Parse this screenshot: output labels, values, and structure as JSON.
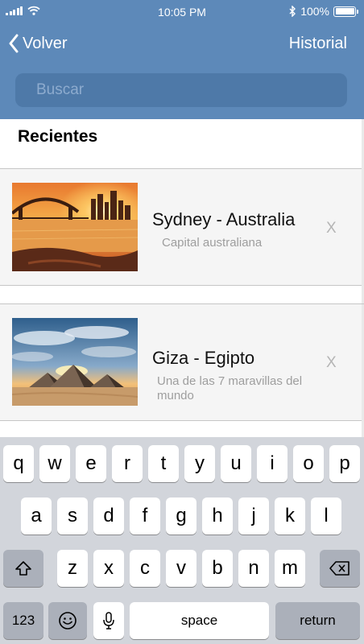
{
  "status_bar": {
    "time": "10:05 PM",
    "battery": "100%"
  },
  "nav": {
    "back_label": "Volver",
    "right_label": "Historial"
  },
  "search": {
    "placeholder": "Buscar"
  },
  "section_title": "Recientes",
  "recent_items": [
    {
      "title": "Sydney - Australia",
      "description": "Capital australiana",
      "remove": "X"
    },
    {
      "title": "Giza - Egipto",
      "description": "Una de las 7 maravillas del mundo",
      "remove": "X"
    }
  ],
  "keyboard": {
    "row1": [
      "q",
      "w",
      "e",
      "r",
      "t",
      "y",
      "u",
      "i",
      "o",
      "p"
    ],
    "row2": [
      "a",
      "s",
      "d",
      "f",
      "g",
      "h",
      "j",
      "k",
      "l"
    ],
    "row3": [
      "z",
      "x",
      "c",
      "v",
      "b",
      "n",
      "m"
    ],
    "numbers_label": "123",
    "space_label": "space",
    "return_label": "return"
  },
  "colors": {
    "header": "#5d89b9",
    "search_field": "#4e79a8",
    "keyboard_bg": "#d2d5db"
  }
}
